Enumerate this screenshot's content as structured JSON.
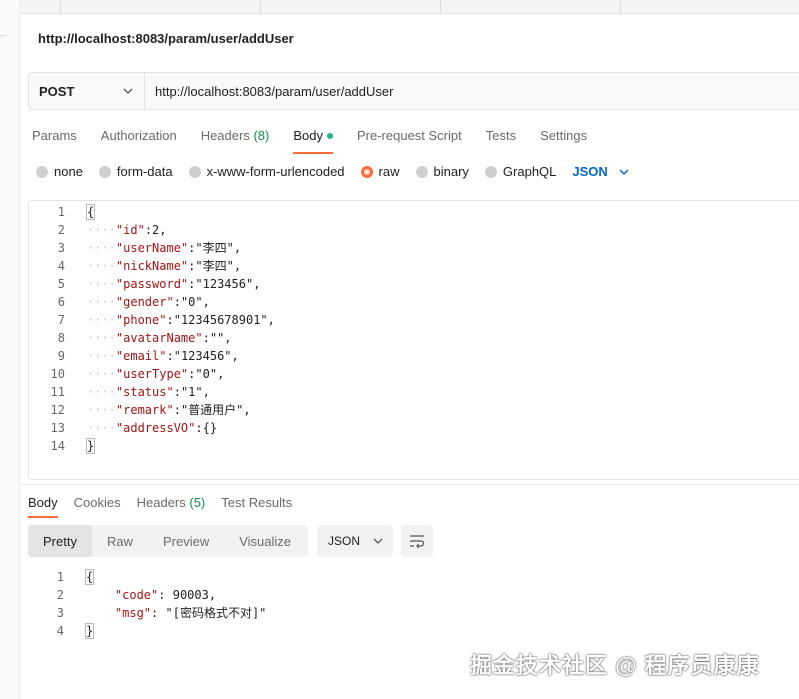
{
  "request": {
    "title": "http://localhost:8083/param/user/addUser",
    "method": "POST",
    "url": "http://localhost:8083/param/user/addUser"
  },
  "request_tabs": [
    {
      "label": "Params"
    },
    {
      "label": "Authorization"
    },
    {
      "label": "Headers",
      "count": "(8)"
    },
    {
      "label": "Body",
      "active": true,
      "indicator": "green-dot"
    },
    {
      "label": "Pre-request Script"
    },
    {
      "label": "Tests"
    },
    {
      "label": "Settings"
    }
  ],
  "body_types": [
    {
      "label": "none",
      "selected": false
    },
    {
      "label": "form-data",
      "selected": false
    },
    {
      "label": "x-www-form-urlencoded",
      "selected": false
    },
    {
      "label": "raw",
      "selected": true
    },
    {
      "label": "binary",
      "selected": false
    },
    {
      "label": "GraphQL",
      "selected": false
    }
  ],
  "body_format": "JSON",
  "request_body_lines": [
    "{",
    "    \"id\":2,",
    "    \"userName\":\"李四\",",
    "    \"nickName\":\"李四\",",
    "    \"password\":\"123456\",",
    "    \"gender\":\"0\",",
    "    \"phone\":\"12345678901\",",
    "    \"avatarName\":\"\",",
    "    \"email\":\"123456\",",
    "    \"userType\":\"0\",",
    "    \"status\":\"1\",",
    "    \"remark\":\"普通用户\",",
    "    \"addressVO\":{}",
    "}"
  ],
  "response_tabs": [
    {
      "label": "Body",
      "active": true
    },
    {
      "label": "Cookies"
    },
    {
      "label": "Headers",
      "count": "(5)"
    },
    {
      "label": "Test Results"
    }
  ],
  "view_modes": [
    {
      "label": "Pretty",
      "active": true
    },
    {
      "label": "Raw"
    },
    {
      "label": "Preview"
    },
    {
      "label": "Visualize"
    }
  ],
  "response_format": "JSON",
  "response_body_lines": [
    "{",
    "    \"code\": 90003,",
    "    \"msg\": \"[密码格式不对]\"",
    "}"
  ],
  "watermark": "掘金技术社区 @ 程序员康康",
  "colors": {
    "accent": "#ff6c37",
    "link": "#0265d2",
    "count": "#168e4c",
    "key": "#a31515",
    "string": "#0451a5",
    "number": "#098658"
  },
  "icons": [
    "chevron-down-icon",
    "wrap-lines-icon",
    "green-dot-icon"
  ]
}
